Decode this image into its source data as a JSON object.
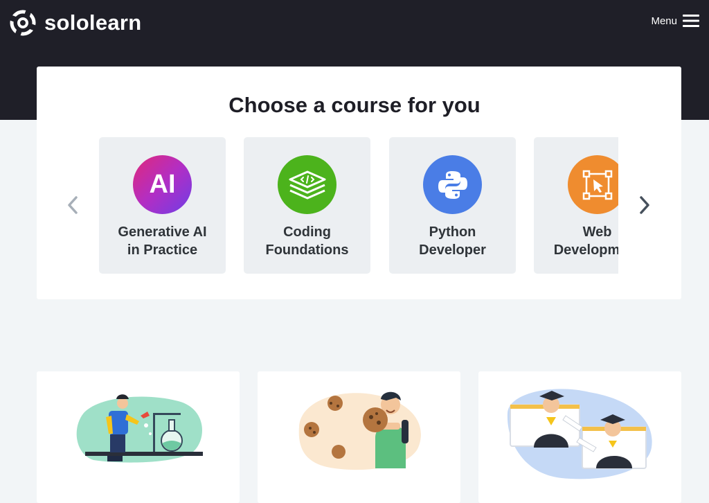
{
  "header": {
    "brand": "sololearn",
    "menu_label": "Menu"
  },
  "section": {
    "title": "Choose a course for you"
  },
  "courses": [
    {
      "line1": "Generative AI",
      "line2": "in Practice",
      "icon": "ai-icon",
      "icon_text": "AI"
    },
    {
      "line1": "Coding",
      "line2": "Foundations",
      "icon": "code-layers-icon"
    },
    {
      "line1": "Python",
      "line2": "Developer",
      "icon": "python-icon"
    },
    {
      "line1": "Web",
      "line2": "Development",
      "icon": "web-cursor-icon"
    }
  ],
  "colors": {
    "header_bg": "#1f1f28",
    "page_bg": "#f2f5f7",
    "coding_green": "#4cb31c",
    "python_blue": "#4a7de6",
    "web_orange": "#ef8c2f"
  }
}
